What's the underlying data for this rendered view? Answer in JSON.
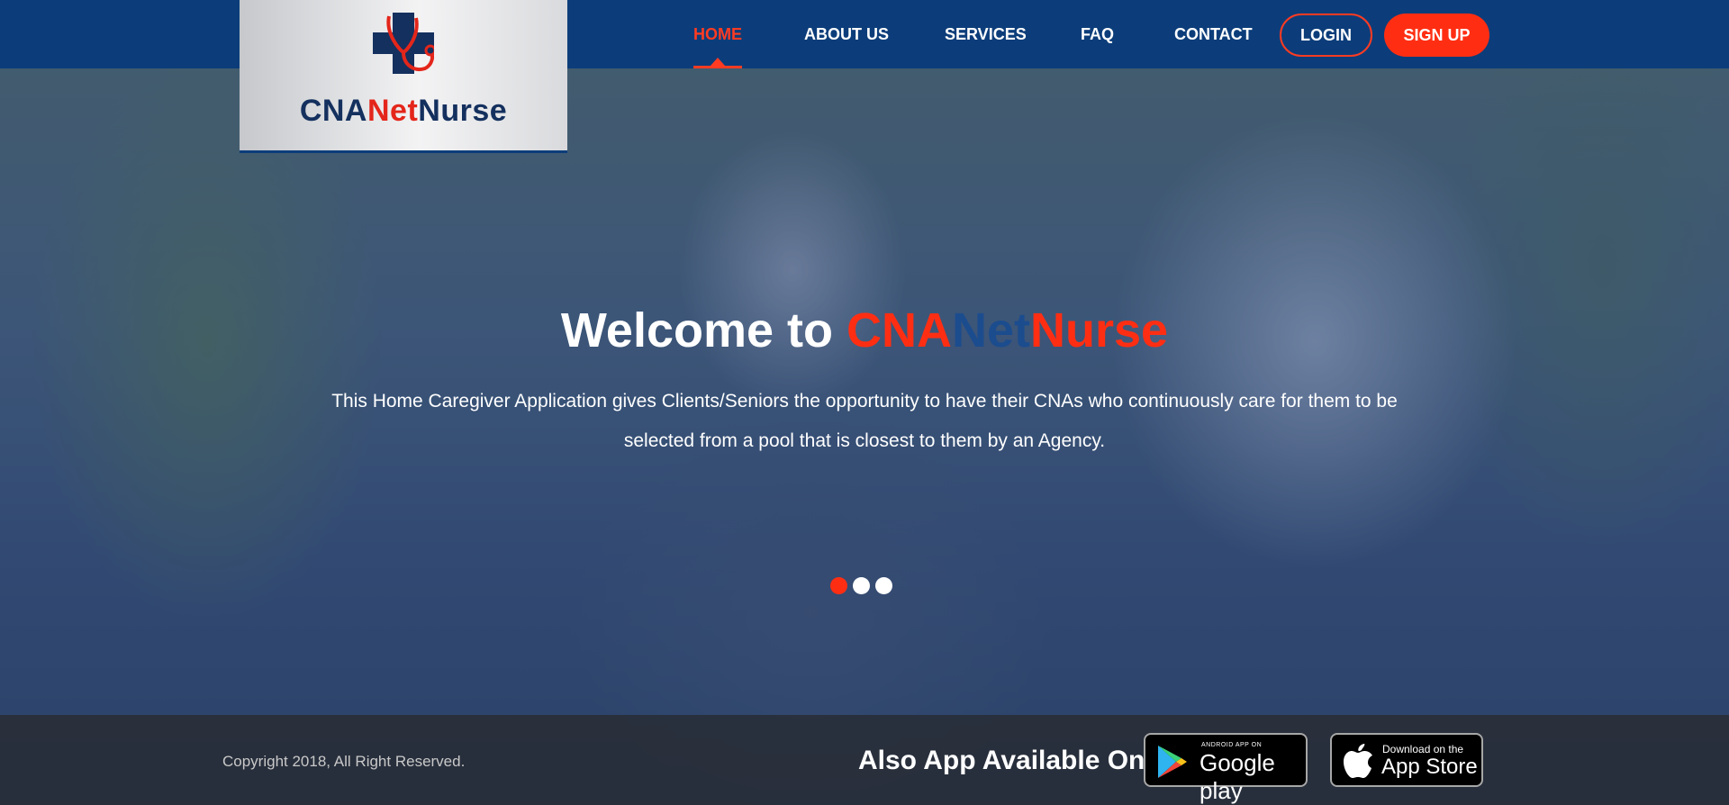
{
  "brand": {
    "logo_part1": "CNA",
    "logo_part2": "Net",
    "logo_part3": "Nurse"
  },
  "nav": {
    "items": [
      {
        "label": "HOME",
        "active": true
      },
      {
        "label": "ABOUT US",
        "active": false
      },
      {
        "label": "SERVICES",
        "active": false
      },
      {
        "label": "FAQ",
        "active": false
      },
      {
        "label": "CONTACT",
        "active": false
      }
    ],
    "login_label": "LOGIN",
    "signup_label": "SIGN UP"
  },
  "hero": {
    "title_prefix": "Welcome to ",
    "title_brand_1": "CNA",
    "title_brand_2": "Net",
    "title_brand_3": "Nurse",
    "subtitle": "This Home Caregiver Application gives Clients/Seniors the opportunity to have their CNAs who continuously care for them to be selected from a pool that is closest to them by an Agency.",
    "slides": {
      "count": 3,
      "active_index": 0
    }
  },
  "footer": {
    "copyright": "Copyright 2018, All Right Reserved.",
    "also_available": "Also App Available On",
    "google_play": {
      "small": "ANDROID APP ON",
      "big": "Google play",
      "icon": "google-play-icon"
    },
    "app_store": {
      "small": "Download on the",
      "big": "App Store",
      "icon": "apple-icon"
    }
  },
  "colors": {
    "navbar": "#0c3d7a",
    "accent_red": "#ff2e13",
    "brand_navy": "#14305e"
  }
}
